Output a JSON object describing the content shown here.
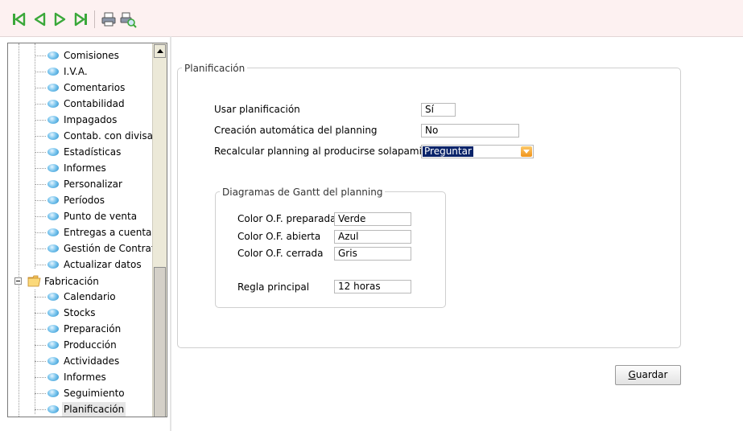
{
  "toolbar": {
    "buttons": [
      "first-record-icon",
      "previous-record-icon",
      "next-record-icon",
      "last-record-icon",
      "print-icon",
      "print-preview-icon"
    ]
  },
  "tree": {
    "items": [
      "Comisiones",
      "I.V.A.",
      "Comentarios",
      "Contabilidad",
      "Impagados",
      "Contab. con divisas",
      "Estadísticas",
      "Informes",
      "Personalizar",
      "Períodos",
      "Punto de venta",
      "Entregas a cuenta",
      "Gestión de Contratos",
      "Actualizar datos"
    ],
    "folder": "Fabricación",
    "children": [
      "Calendario",
      "Stocks",
      "Preparación",
      "Producción",
      "Actividades",
      "Informes",
      "Seguimiento",
      "Planificación"
    ]
  },
  "planificacion": {
    "legend": "Planificación",
    "usar_label": "Usar planificación",
    "usar_value": "Sí",
    "creacion_label": "Creación automática del planning",
    "creacion_value": "No",
    "recalcular_label": "Recalcular planning al producirse solapamientos",
    "recalcular_value": "Preguntar"
  },
  "gantt": {
    "legend": "Diagramas de Gantt del planning",
    "preparada_label": "Color O.F. preparada",
    "preparada_value": "Verde",
    "abierta_label": "Color O.F. abierta",
    "abierta_value": "Azul",
    "cerrada_label": "Color O.F. cerrada",
    "cerrada_value": "Gris",
    "regla_label": "Regla principal",
    "regla_value": "12 horas"
  },
  "save": {
    "first_letter": "G",
    "rest": "uardar"
  },
  "colors": {
    "toolbar_green": "#3aa83a",
    "selected_value_bg": "#0a246a",
    "dropdown_arrow": "#f0941c"
  }
}
